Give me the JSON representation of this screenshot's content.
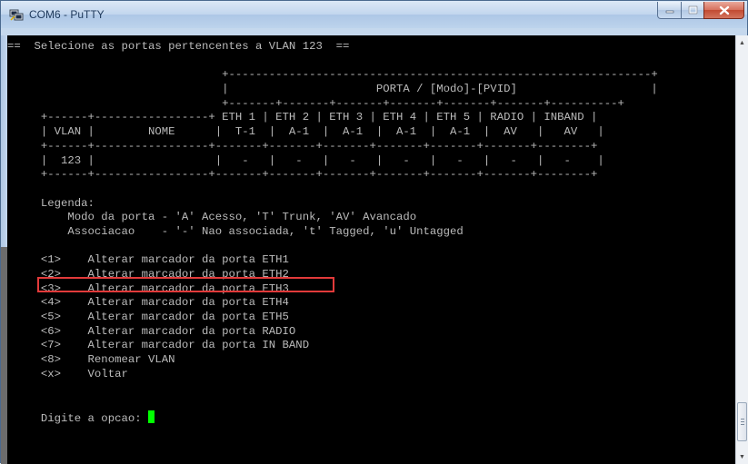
{
  "window": {
    "title": "COM6 - PuTTY",
    "icons": {
      "app": "putty-icon",
      "minimize": "minimize-icon",
      "maximize": "maximize-icon",
      "close": "close-icon"
    }
  },
  "terminal": {
    "colors": {
      "background": "#000000",
      "text": "#bbbbbb",
      "cursor": "#00ff00",
      "highlight": "#e23a3a"
    },
    "lines": [
      "==  Selecione as portas pertencentes a VLAN 123  ==",
      "",
      "                                +---------------------------------------------------------------+",
      "                                |                      PORTA / [Modo]-[PVID]                    |",
      "                                +-------+-------+-------+-------+-------+-------+----------+",
      "     +------+-----------------+ ETH 1 | ETH 2 | ETH 3 | ETH 4 | ETH 5 | RADIO | INBAND |",
      "     | VLAN |        NOME      |  T-1  |  A-1  |  A-1  |  A-1  |  A-1  |  AV   |   AV   |",
      "     +------+-----------------+-------+-------+-------+-------+-------+-------+--------+",
      "     |  123 |                  |   -   |   -   |   -   |   -   |   -   |   -   |   -    |",
      "     +------+-----------------+-------+-------+-------+-------+-------+-------+--------+",
      "",
      "     Legenda:",
      "         Modo da porta - 'A' Acesso, 'T' Trunk, 'AV' Avancado",
      "         Associacao    - '-' Nao associada, 't' Tagged, 'u' Untagged",
      "",
      "     <1>    Alterar marcador da porta ETH1",
      "     <2>    Alterar marcador da porta ETH2",
      "     <3>    Alterar marcador da porta ETH3",
      "     <4>    Alterar marcador da porta ETH4",
      "     <5>    Alterar marcador da porta ETH5",
      "     <6>    Alterar marcador da porta RADIO",
      "     <7>    Alterar marcador da porta IN BAND",
      "     <8>    Renomear VLAN",
      "     <x>    Voltar",
      "",
      "",
      "     Digite a opcao: "
    ]
  }
}
